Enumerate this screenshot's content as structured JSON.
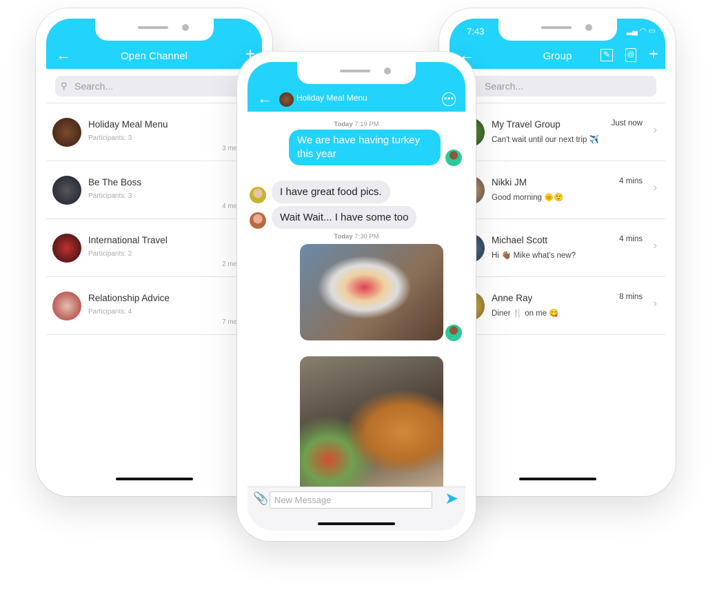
{
  "left": {
    "title": "Open Channel",
    "search_placeholder": "Search...",
    "items": [
      {
        "name": "Holiday Meal Menu",
        "participants": "Participants: 3",
        "messages": "3 messages"
      },
      {
        "name": "Be The Boss",
        "participants": "Participants: 3",
        "messages": "4 messages"
      },
      {
        "name": "International Travel",
        "participants": "Participants: 2",
        "messages": "2 messages"
      },
      {
        "name": "Relationship Advice",
        "participants": "Participants: 4",
        "messages": "7 messages"
      }
    ]
  },
  "center": {
    "title": "Holiday Meal Menu",
    "ts1_day": "Today",
    "ts1_time": "7:19 PM",
    "msg1": "We are have having turkey this year",
    "msg2": "I have great food pics.",
    "msg3": "Wait Wait... I have some too",
    "ts2_day": "Today",
    "ts2_time": "7:30 PM",
    "input_placeholder": "New Message"
  },
  "right": {
    "time": "7:43",
    "title": "Group",
    "search_placeholder": "Search...",
    "items": [
      {
        "name": "My Travel Group",
        "preview": "Can't wait until our next trip ✈️",
        "time": "Just now"
      },
      {
        "name": "Nikki JM",
        "preview": "Good morning 🌞🙂",
        "time": "4 mins"
      },
      {
        "name": "Michael Scott",
        "preview": "Hi 👋🏾 Mike what's new?",
        "time": "4 mins"
      },
      {
        "name": "Anne Ray",
        "preview": "Diner 🍴 on me 😋",
        "time": "8 mins"
      }
    ]
  },
  "colors": {
    "accent": "#22d3fb",
    "bubble_in": "#ebebf0"
  }
}
